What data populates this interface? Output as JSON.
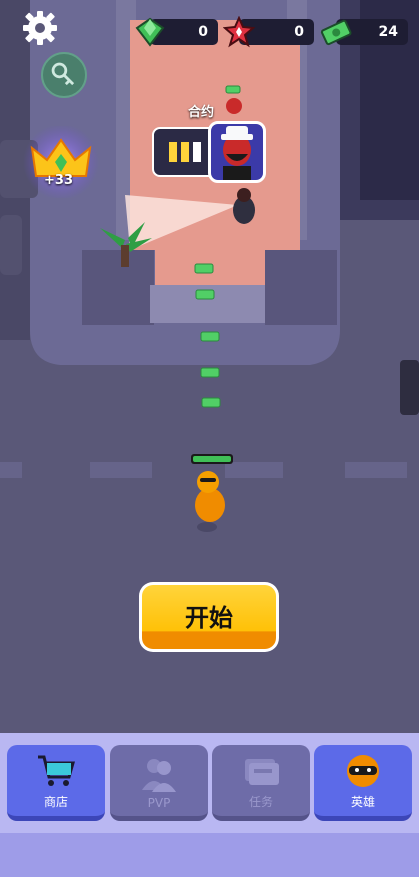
{
  "resources": {
    "gems": "0",
    "tokens": "0",
    "cash": "24"
  },
  "crown": {
    "count": "+33"
  },
  "contract": {
    "label": "合约"
  },
  "start": {
    "label": "开始"
  },
  "player": {
    "health_fraction": 1.0
  },
  "nav": {
    "items": [
      {
        "label": "商店",
        "state": "active"
      },
      {
        "label": "PVP",
        "state": "locked"
      },
      {
        "label": "任务",
        "state": "locked"
      },
      {
        "label": "英雄",
        "state": "active"
      }
    ]
  },
  "colors": {
    "ground": "#5a5878",
    "floor": "#e59a8e",
    "accent_yellow": "#ffc107",
    "nav_active": "#5c6ae8",
    "nav_locked": "#6e6ca8",
    "gem": "#40c057",
    "token": "#e03140",
    "cash": "#51cf66"
  }
}
